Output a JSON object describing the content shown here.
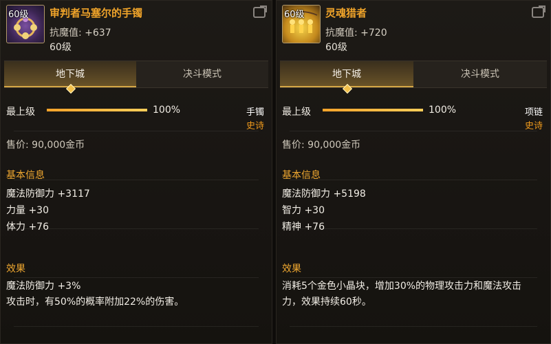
{
  "left": {
    "level_badge": "60级",
    "name": "审判者马塞尔的手镯",
    "magic_resist_label": "抗魔值:",
    "magic_resist_value": "+637",
    "level": "60级",
    "tabs": [
      "地下城",
      "决斗模式"
    ],
    "grade_label": "最上级",
    "grade_percent": "100%",
    "grade_value": 100,
    "slot": "手镯",
    "rarity": "史诗",
    "price": "售价: 90,000金币",
    "basic_title": "基本信息",
    "attributes": [
      "魔法防御力 +3117",
      "力量 +30",
      "体力 +76"
    ],
    "effect_title": "效果",
    "effects": [
      "魔法防御力 +3%",
      "攻击时，有50%的概率附加22%的伤害。"
    ],
    "icon": "purple-bracelet-icon"
  },
  "right": {
    "level_badge": "60级",
    "name": "灵魂猎者",
    "magic_resist_label": "抗魔值:",
    "magic_resist_value": "+720",
    "level": "60级",
    "tabs": [
      "地下城",
      "决斗模式"
    ],
    "grade_label": "最上级",
    "grade_percent": "100%",
    "grade_value": 100,
    "slot": "项链",
    "rarity": "史诗",
    "price": "售价: 90,000金币",
    "basic_title": "基本信息",
    "attributes": [
      "魔法防御力 +5198",
      "智力 +30",
      "精神 +76"
    ],
    "effect_title": "效果",
    "effects": [
      "消耗5个金色小晶块，增加30%的物理攻击力和魔法攻击",
      "力，效果持续60秒。"
    ],
    "icon": "golden-figures-necklace-icon"
  },
  "colors": {
    "title_orange": "#f0a42a",
    "section_orange": "#f0a830",
    "rarity_orange": "#f09a1c",
    "bar_fill": "#f4a32a",
    "panel_bg": "#1d1a16"
  }
}
